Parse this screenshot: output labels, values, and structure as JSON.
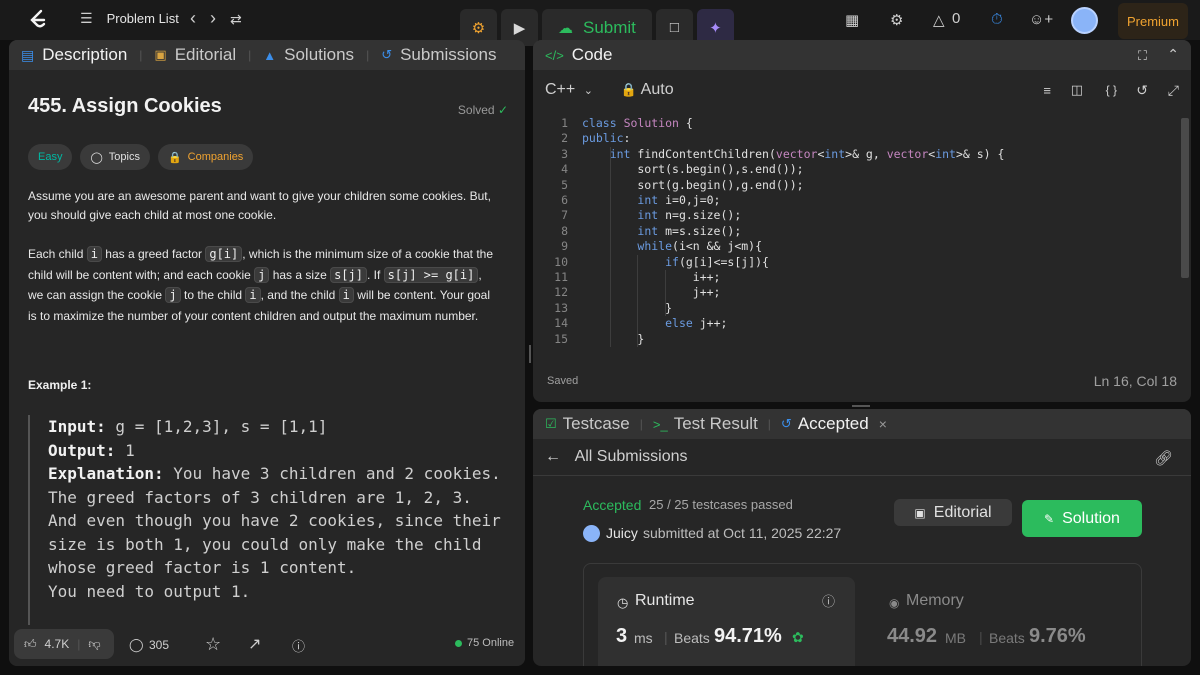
{
  "topbar": {
    "problem_list": "Problem List",
    "submit": "Submit",
    "fire_count": "0",
    "premium": "Premium"
  },
  "description": {
    "tabs": [
      "Description",
      "Editorial",
      "Solutions",
      "Submissions"
    ],
    "title": "455. Assign Cookies",
    "solved": "Solved",
    "tags": [
      "Easy",
      "Topics",
      "Companies"
    ],
    "para1": "Assume you are an awesome parent and want to give your children some cookies. But, you should give each child at most one cookie.",
    "para2_parts": [
      "Each child ",
      "i",
      " has a greed factor ",
      "g[i]",
      ", which is the minimum size of a cookie that the child will be content with; and each cookie ",
      "j",
      " has a size ",
      "s[j]",
      ". If ",
      "s[j] >= g[i]",
      ", we can assign the cookie ",
      "j",
      " to the child ",
      "i",
      ", and the child ",
      "i",
      " will be content. Your goal is to maximize the number of your content children and output the maximum number."
    ],
    "example_title": "Example 1:",
    "input_label": "Input:",
    "input_value": " g = [1,2,3], s = [1,1]",
    "output_label": "Output:",
    "output_value": " 1",
    "explanation_label": "Explanation:",
    "explanation_value": " You have 3 children and 2 cookies. The greed factors of 3 children are 1, 2, 3.",
    "explanation_more": "And even though you have 2 cookies, since their size is both 1, you could only make the child whose greed factor is 1 content.",
    "explanation_end": "You need to output 1.",
    "likes": "4.7K",
    "comments": "305",
    "online": "75 Online"
  },
  "code": {
    "title": "Code",
    "language": "C++",
    "mode": "Auto",
    "status": "Saved",
    "cursor": "Ln 16, Col 18",
    "lines": [
      "class Solution {",
      "public:",
      "    int findContentChildren(vector<int>& g, vector<int>& s) {",
      "        sort(s.begin(),s.end());",
      "        sort(g.begin(),g.end());",
      "        int i=0,j=0;",
      "        int n=g.size();",
      "        int m=s.size();",
      "        while(i<n && j<m){",
      "            if(g[i]<=s[j]){",
      "                i++;",
      "                j++;",
      "            }",
      "            else j++;",
      "        }"
    ]
  },
  "result": {
    "tabs": [
      "Testcase",
      "Test Result",
      "Accepted"
    ],
    "all_submissions": "All Submissions",
    "status": "Accepted",
    "passed": "25 / 25 testcases passed",
    "user": "Juicy",
    "submitted_at": "submitted at Oct 11, 2025 22:27",
    "editorial_btn": "Editorial",
    "solution_btn": "Solution",
    "runtime_label": "Runtime",
    "runtime_value": "3",
    "runtime_unit": "ms",
    "beats_label": "Beats",
    "runtime_beats": "94.71%",
    "memory_label": "Memory",
    "memory_value": "44.92",
    "memory_unit": "MB",
    "memory_beats": "9.76%"
  },
  "colors": {
    "accent_green": "#2cbb5d",
    "easy": "#00b8a3",
    "premium": "#f0a330",
    "blue": "#3b8eea"
  }
}
